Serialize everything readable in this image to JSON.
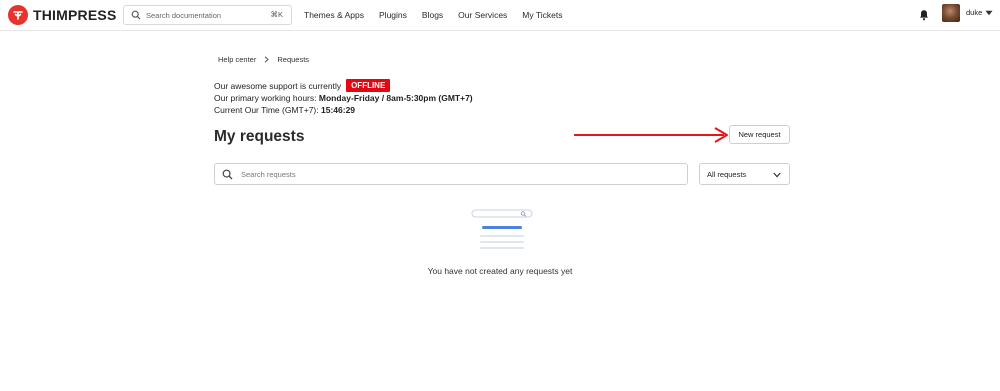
{
  "brand": {
    "name": "THIMPRESS",
    "accent": "#e8322d"
  },
  "header": {
    "search_placeholder": "Search documentation",
    "search_shortcut": "⌘K",
    "nav": [
      "Themes & Apps",
      "Plugins",
      "Blogs",
      "Our Services",
      "My Tickets"
    ],
    "user_name": "duke"
  },
  "breadcrumb": [
    "Help center",
    "Requests"
  ],
  "support": {
    "status_prefix": "Our awesome support is currently",
    "status_badge": "OFFLINE",
    "status_color": "#e30613",
    "hours_label": "Our primary working hours:",
    "hours_value": "Monday-Friday / 8am-5:30pm (GMT+7)",
    "time_label": "Current Our Time (GMT+7):",
    "time_value": "15:46:29"
  },
  "page": {
    "title": "My requests",
    "new_request_label": "New request",
    "search_placeholder": "Search requests",
    "filter_value": "All requests",
    "empty_message": "You have not created any requests yet"
  },
  "annotation": {
    "arrow_color": "#e3171b"
  }
}
